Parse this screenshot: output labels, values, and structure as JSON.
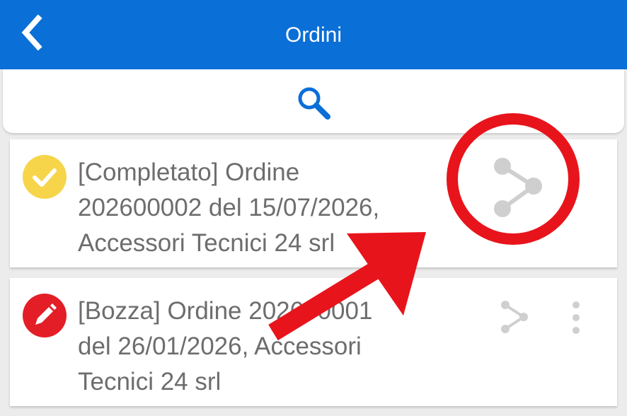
{
  "header": {
    "title": "Ordini",
    "background": "#0a6fd6",
    "back_icon": "chevron-left-icon"
  },
  "search": {
    "icon": "search-icon",
    "icon_color": "#0a6fd6"
  },
  "orders": [
    {
      "status_icon": "check-icon",
      "status_color": "#f6d54a",
      "lines": [
        "[Completato] Ordine",
        "202600002 del 15/07/2026,",
        "Accessori Tecnici 24 srl"
      ],
      "action_icon": "share-icon"
    },
    {
      "status_icon": "pencil-icon",
      "status_color": "#e41e26",
      "lines": [
        "[Bozza] Ordine 202600001",
        "del 26/01/2026, Accessori",
        "Tecnici 24 srl"
      ],
      "action_icons": [
        "share-icon",
        "more-vertical-icon"
      ]
    }
  ],
  "annotation": {
    "color": "#e8141c",
    "shapes": [
      "circle-highlight",
      "arrow-pointer"
    ]
  }
}
